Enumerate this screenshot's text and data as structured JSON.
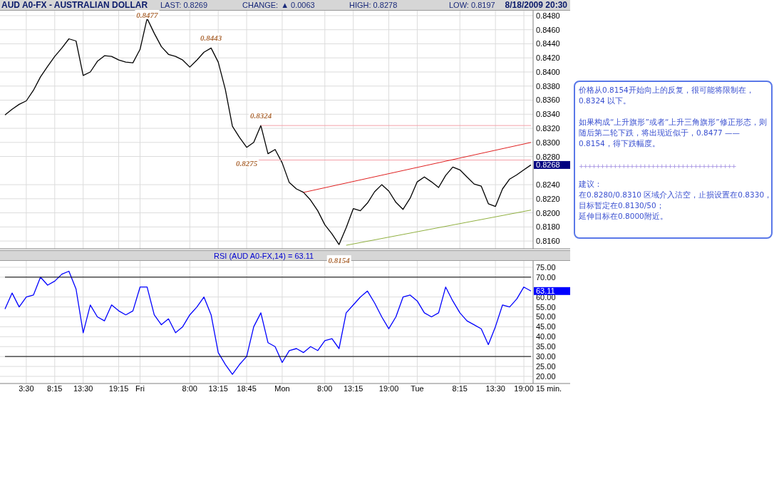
{
  "quote_bar": {
    "symbol": "AUD A0-FX - AUSTRALIAN DOLLAR",
    "last": "LAST: 0.8269",
    "change_label": "CHANGE:",
    "change": "▲ 0.0063",
    "high": "HIGH: 0.8278",
    "low": "LOW: 0.8197",
    "datetime": "8/18/2009 20:30"
  },
  "price_panel": {
    "chart_data": {
      "type": "line",
      "ylim": [
        0.8149,
        0.8487
      ],
      "yticks": [
        {
          "value": 0.816,
          "label": "0.8160"
        },
        {
          "value": 0.818,
          "label": "0.8180"
        },
        {
          "value": 0.82,
          "label": "0.8200"
        },
        {
          "value": 0.822,
          "label": "0.8220"
        },
        {
          "value": 0.824,
          "label": "0.8240"
        },
        {
          "value": 0.828,
          "label": "0.8280"
        },
        {
          "value": 0.83,
          "label": "0.8300"
        },
        {
          "value": 0.832,
          "label": "0.8320"
        },
        {
          "value": 0.834,
          "label": "0.8340"
        },
        {
          "value": 0.836,
          "label": "0.8360"
        },
        {
          "value": 0.838,
          "label": "0.8380"
        },
        {
          "value": 0.84,
          "label": "0.8400"
        },
        {
          "value": 0.842,
          "label": "0.8420"
        },
        {
          "value": 0.844,
          "label": "0.8440"
        },
        {
          "value": 0.846,
          "label": "0.8460"
        },
        {
          "value": 0.848,
          "label": "0.8480"
        }
      ],
      "series": [
        {
          "color": "#000000",
          "values": [
            0.8339,
            0.8347,
            0.8354,
            0.8359,
            0.8374,
            0.8393,
            0.8408,
            0.8422,
            0.8434,
            0.8447,
            0.8444,
            0.8395,
            0.84,
            0.8415,
            0.8423,
            0.8422,
            0.8417,
            0.8414,
            0.8413,
            0.8432,
            0.8476,
            0.8455,
            0.8436,
            0.8425,
            0.8422,
            0.8417,
            0.8407,
            0.8417,
            0.8428,
            0.8434,
            0.8414,
            0.8375,
            0.8323,
            0.8307,
            0.8293,
            0.83,
            0.8324,
            0.8284,
            0.829,
            0.8271,
            0.8243,
            0.8234,
            0.8229,
            0.8218,
            0.8203,
            0.8183,
            0.817,
            0.8155,
            0.8179,
            0.8206,
            0.8203,
            0.8214,
            0.823,
            0.824,
            0.8231,
            0.8215,
            0.8205,
            0.8221,
            0.8244,
            0.8251,
            0.8244,
            0.8236,
            0.8253,
            0.8265,
            0.8261,
            0.8251,
            0.8241,
            0.8238,
            0.8213,
            0.8209,
            0.8234,
            0.8248,
            0.8254,
            0.8261,
            0.8268
          ]
        },
        {
          "color": "#f4a0a8",
          "values": [
            null,
            null,
            null,
            null,
            null,
            null,
            null,
            null,
            null,
            null,
            null,
            null,
            null,
            null,
            null,
            null,
            null,
            null,
            null,
            null,
            null,
            null,
            null,
            null,
            null,
            null,
            null,
            null,
            null,
            null,
            null,
            null,
            null,
            null,
            null,
            null,
            0.8324,
            null,
            null,
            null,
            null,
            null,
            null,
            null,
            null,
            null,
            null,
            null,
            null,
            null,
            null,
            null,
            null,
            null,
            null,
            null,
            null,
            null,
            null,
            null,
            null,
            null,
            null,
            null,
            null,
            null,
            null,
            null,
            null,
            null,
            null,
            null,
            null,
            null,
            0.8324
          ]
        },
        {
          "color": "#f4a0a8",
          "values": [
            null,
            null,
            null,
            null,
            null,
            null,
            null,
            null,
            null,
            null,
            null,
            null,
            null,
            null,
            null,
            null,
            null,
            null,
            null,
            null,
            null,
            null,
            null,
            null,
            null,
            null,
            null,
            null,
            null,
            null,
            null,
            null,
            null,
            null,
            0.8275,
            null,
            null,
            null,
            null,
            null,
            null,
            null,
            null,
            null,
            null,
            null,
            null,
            null,
            null,
            null,
            null,
            null,
            null,
            null,
            null,
            null,
            null,
            null,
            null,
            null,
            null,
            null,
            null,
            null,
            null,
            null,
            null,
            null,
            null,
            null,
            null,
            null,
            null,
            null,
            0.8275
          ]
        },
        {
          "color": "#e02020",
          "values": [
            null,
            null,
            null,
            null,
            null,
            null,
            null,
            null,
            null,
            null,
            null,
            null,
            null,
            null,
            null,
            null,
            null,
            null,
            null,
            null,
            null,
            null,
            null,
            null,
            null,
            null,
            null,
            null,
            null,
            null,
            null,
            null,
            null,
            null,
            null,
            null,
            null,
            null,
            null,
            null,
            null,
            null,
            0.8229,
            null,
            null,
            null,
            null,
            null,
            null,
            null,
            null,
            null,
            null,
            null,
            null,
            null,
            null,
            null,
            null,
            null,
            null,
            null,
            null,
            null,
            null,
            null,
            null,
            null,
            null,
            null,
            null,
            null,
            null,
            null,
            0.83
          ]
        },
        {
          "color": "#90b040",
          "values": [
            null,
            null,
            null,
            null,
            null,
            null,
            null,
            null,
            null,
            null,
            null,
            null,
            null,
            null,
            null,
            null,
            null,
            null,
            null,
            null,
            null,
            null,
            null,
            null,
            null,
            null,
            null,
            null,
            null,
            null,
            null,
            null,
            null,
            null,
            null,
            null,
            null,
            null,
            null,
            null,
            null,
            null,
            null,
            null,
            null,
            null,
            null,
            null,
            0.8154,
            null,
            null,
            null,
            null,
            null,
            null,
            null,
            null,
            null,
            null,
            null,
            null,
            null,
            null,
            null,
            null,
            null,
            null,
            null,
            null,
            null,
            null,
            null,
            null,
            null,
            0.8204
          ]
        }
      ],
      "grid": true,
      "annotations": [
        {
          "text": "0.8477",
          "y": 0.8476
        },
        {
          "text": "0.8443",
          "y": 0.8434
        },
        {
          "text": "0.8324",
          "y": 0.8324
        },
        {
          "text": "0.8275",
          "y": 0.8293
        },
        {
          "text": "0.8154",
          "y": 0.8155
        }
      ]
    },
    "last_tag": "0.8268"
  },
  "rsi_panel": {
    "chart_data": {
      "type": "line",
      "title": "RSI (AUD A0-FX,14) = 63.11",
      "xlabel": "15 min.",
      "ylim": [
        16.4,
        78.2
      ],
      "yticks": [
        {
          "value": 20,
          "label": "20.00"
        },
        {
          "value": 25,
          "label": "25.00"
        },
        {
          "value": 30,
          "label": "30.00"
        },
        {
          "value": 35,
          "label": "35.00"
        },
        {
          "value": 40,
          "label": "40.00"
        },
        {
          "value": 45,
          "label": "45.00"
        },
        {
          "value": 50,
          "label": "50.00"
        },
        {
          "value": 55,
          "label": "55.00"
        },
        {
          "value": 60,
          "label": "60.00"
        },
        {
          "value": 70,
          "label": "70.00"
        },
        {
          "value": 75,
          "label": "75.00"
        }
      ],
      "categories": [
        null,
        null,
        null,
        "3:30",
        null,
        null,
        null,
        "8:15",
        null,
        null,
        null,
        "13:30",
        null,
        null,
        null,
        null,
        "19:15",
        null,
        null,
        "Fri",
        null,
        null,
        null,
        null,
        null,
        null,
        "8:00",
        null,
        null,
        null,
        "13:15",
        null,
        null,
        null,
        "18:45",
        null,
        null,
        null,
        null,
        "Mon",
        null,
        null,
        null,
        null,
        null,
        "8:00",
        null,
        null,
        null,
        "13:15",
        null,
        null,
        null,
        null,
        "19:00",
        null,
        null,
        null,
        "Tue",
        null,
        null,
        null,
        null,
        null,
        "8:15",
        null,
        null,
        null,
        null,
        "13:30",
        null,
        null,
        null,
        "19:00",
        null
      ],
      "series": [
        {
          "color": "#0000ff",
          "values": [
            54,
            62,
            55,
            60,
            61,
            70,
            66,
            68,
            71.5,
            73,
            64,
            42,
            56,
            50,
            48,
            56,
            53,
            51,
            53,
            65,
            65,
            51,
            46,
            49,
            42,
            45,
            51,
            55,
            60,
            51,
            32,
            26,
            21,
            26,
            30,
            45,
            52,
            37,
            35,
            27,
            33,
            34,
            32,
            35,
            33,
            38,
            39,
            34,
            52,
            56,
            60,
            63,
            57,
            50,
            44,
            50,
            60,
            61,
            58,
            52,
            50,
            52,
            65,
            58,
            52,
            48,
            46,
            44,
            36,
            45,
            56,
            55,
            59,
            65,
            63
          ]
        },
        {
          "color": "#000000",
          "values": [
            70,
            null,
            null,
            null,
            null,
            null,
            null,
            null,
            null,
            null,
            null,
            null,
            null,
            null,
            null,
            null,
            null,
            null,
            null,
            null,
            null,
            null,
            null,
            null,
            null,
            null,
            null,
            null,
            null,
            null,
            null,
            null,
            null,
            null,
            null,
            null,
            null,
            null,
            null,
            null,
            null,
            null,
            null,
            null,
            null,
            null,
            null,
            null,
            null,
            null,
            null,
            null,
            null,
            null,
            null,
            null,
            null,
            null,
            null,
            null,
            null,
            null,
            null,
            null,
            null,
            null,
            null,
            null,
            null,
            null,
            null,
            null,
            null,
            null,
            70
          ]
        },
        {
          "color": "#000000",
          "values": [
            30,
            null,
            null,
            null,
            null,
            null,
            null,
            null,
            null,
            null,
            null,
            null,
            null,
            null,
            null,
            null,
            null,
            null,
            null,
            null,
            null,
            null,
            null,
            null,
            null,
            null,
            null,
            null,
            null,
            null,
            null,
            null,
            null,
            null,
            null,
            null,
            null,
            null,
            null,
            null,
            null,
            null,
            null,
            null,
            null,
            null,
            null,
            null,
            null,
            null,
            null,
            null,
            null,
            null,
            null,
            null,
            null,
            null,
            null,
            null,
            null,
            null,
            null,
            null,
            null,
            null,
            null,
            null,
            null,
            null,
            null,
            null,
            null,
            null,
            30
          ]
        }
      ],
      "grid": true
    },
    "last_tag": "63.11"
  },
  "note": {
    "paragraphs": [
      "价格从0.8154开始向上的反复，很可能将限制在，0.8324 以下。",
      "如果构成“上升旗形”或者“上升三角旗形”修正形态，则随后第二轮下跌，将出现近似于，0.8477 ——0.8154，得下跌幅度。"
    ],
    "divider": "+++++++++++++++++++++++++++++++++++++",
    "advice_title": "建议：",
    "advice_lines": [
      "在0.8280/0.8310 区域介入沽空，止损设置在0.8330，",
      "目标暂定在0.8130/50；",
      "延伸目标在0.8000附近。"
    ]
  }
}
